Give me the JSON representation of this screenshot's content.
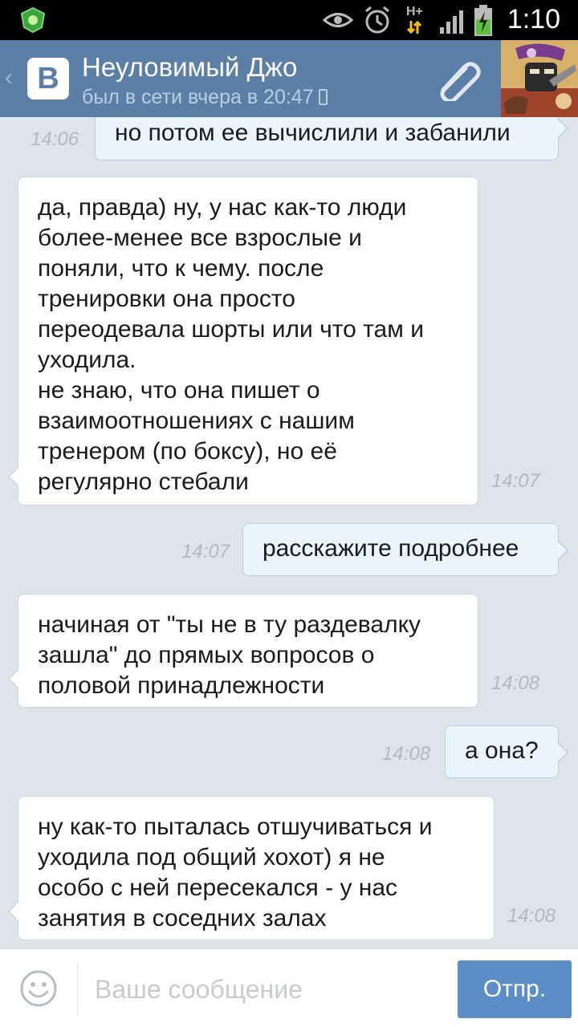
{
  "status_bar": {
    "time": "1:10",
    "network_label": "H+"
  },
  "header": {
    "contact_name": "Неуловимый Джо",
    "contact_status": "был в сети вчера в 20:47",
    "vk_logo": "B"
  },
  "messages": [
    {
      "direction": "out",
      "text": "но потом ее вычислили и забанили",
      "time": "14:06"
    },
    {
      "direction": "in",
      "text": "да, правда) ну, у нас как-то люди\nболее-менее все взрослые и\nпоняли, что к чему. после\nтренировки она просто\nпереодевала шорты или что там и\nуходила.\nне знаю, что она пишет о\nвзаимоотношениях с нашим\nтренером (по боксу), но её\nрегулярно стебали",
      "time": "14:07"
    },
    {
      "direction": "out",
      "text": "расскажите подробнее",
      "time": "14:07"
    },
    {
      "direction": "in",
      "text": "начиная от \"ты не в ту раздевалку\nзашла\" до прямых вопросов о\nполовой принадлежности",
      "time": "14:08"
    },
    {
      "direction": "out",
      "text": "а она?",
      "time": "14:08"
    },
    {
      "direction": "in",
      "text": "ну как-то пыталась отшучиваться и\nуходила под общий хохот) я не\nособо с ней пересекался - у нас\nзанятия в соседних залах",
      "time": "14:08"
    }
  ],
  "composer": {
    "placeholder": "Ваше сообщение",
    "value": "",
    "send_label": "Отпр."
  },
  "colors": {
    "header_bg": "#5b7fa7",
    "chat_bg": "#dfe3ea",
    "outgoing_bubble": "#e9f4fc",
    "incoming_bubble": "#ffffff",
    "send_button": "#5b8ec6"
  }
}
